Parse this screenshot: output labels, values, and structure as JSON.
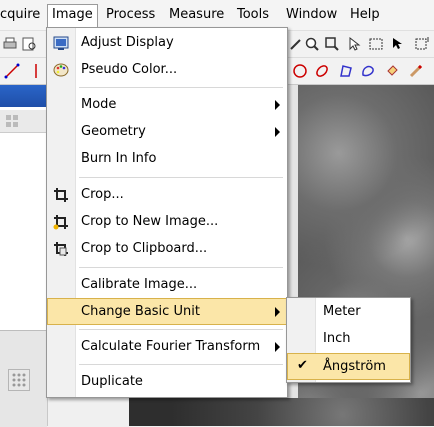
{
  "menubar": {
    "items": [
      "cquire",
      "Image",
      "Process",
      "Measure",
      "Tools",
      "Window",
      "Help"
    ],
    "active": "Image"
  },
  "image_menu": {
    "items": [
      {
        "label": "Adjust Display",
        "icon": "adjust-display-icon"
      },
      {
        "label": "Pseudo Color...",
        "icon": "palette-icon"
      },
      {
        "label": "Mode",
        "submenu": true
      },
      {
        "label": "Geometry",
        "submenu": true
      },
      {
        "label": "Burn In Info"
      },
      {
        "label": "Crop...",
        "icon": "crop-icon"
      },
      {
        "label": "Crop to New Image...",
        "icon": "crop-new-image-icon"
      },
      {
        "label": "Crop to Clipboard...",
        "icon": "crop-clipboard-icon"
      },
      {
        "label": "Calibrate Image..."
      },
      {
        "label": "Change Basic Unit",
        "submenu": true,
        "highlighted": true
      },
      {
        "label": "Calculate Fourier Transform",
        "submenu": true
      },
      {
        "label": "Duplicate"
      }
    ]
  },
  "unit_submenu": {
    "items": [
      {
        "label": "Meter"
      },
      {
        "label": "Inch"
      },
      {
        "label": "Ångström",
        "checked": true,
        "highlighted": true
      }
    ]
  },
  "colors": {
    "highlight": "#fbe6a8",
    "highlight_border": "#d8b24b",
    "title_blue": "#2a64c8"
  }
}
